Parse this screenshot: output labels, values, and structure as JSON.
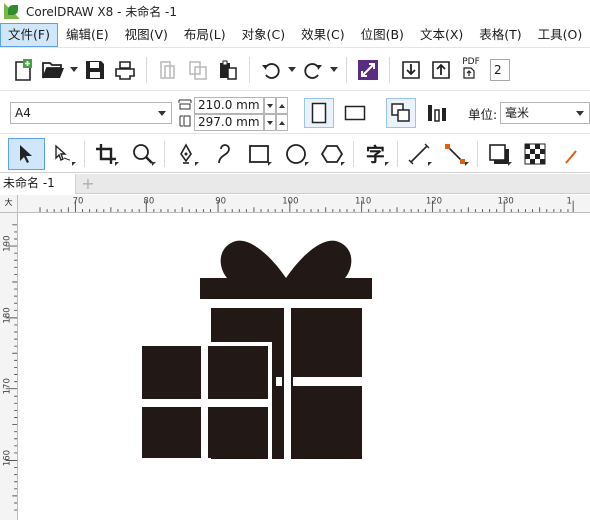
{
  "window": {
    "title": "CorelDRAW X8 - 未命名 -1"
  },
  "menu": [
    {
      "label": "文件(F)",
      "active": true
    },
    {
      "label": "编辑(E)"
    },
    {
      "label": "视图(V)"
    },
    {
      "label": "布局(L)"
    },
    {
      "label": "对象(C)"
    },
    {
      "label": "效果(C)"
    },
    {
      "label": "位图(B)"
    },
    {
      "label": "文本(X)"
    },
    {
      "label": "表格(T)"
    },
    {
      "label": "工具(O)"
    }
  ],
  "toolbar": {
    "pdf_label": "PDF",
    "zoom_value": "2"
  },
  "property_bar": {
    "paper_size": "A4",
    "width": "210.0 mm",
    "height": "297.0 mm",
    "units_label": "单位:",
    "units_value": "毫米"
  },
  "toolbox": {
    "text_tool_glyph": "字"
  },
  "document": {
    "tab_label": "未命名 -1",
    "add_tab": "+"
  },
  "rulers": {
    "corner_label": "大",
    "horizontal_ticks": [
      "70",
      "80",
      "90",
      "100",
      "110",
      "120",
      "130",
      "1"
    ],
    "vertical_ticks": [
      "190",
      "180",
      "170",
      "160"
    ]
  },
  "colors": {
    "accent": "#5ea1e6",
    "menu_active_bg": "#cfe6fb",
    "gift_fill": "#221815",
    "icon_purple": "#5a2d82"
  },
  "icons": [
    "new-document-icon",
    "open-folder-icon",
    "save-icon",
    "print-icon",
    "import-icon",
    "export-icon",
    "publish-pdf-icon",
    "undo-icon",
    "redo-icon",
    "pick-tool-icon",
    "shape-tool-icon",
    "crop-tool-icon",
    "zoom-tool-icon",
    "freehand-tool-icon",
    "artistic-media-icon",
    "rectangle-tool-icon",
    "ellipse-tool-icon",
    "polygon-tool-icon",
    "text-tool-icon",
    "parallel-dimension-icon",
    "connector-tool-icon",
    "drop-shadow-icon",
    "transparency-icon"
  ]
}
